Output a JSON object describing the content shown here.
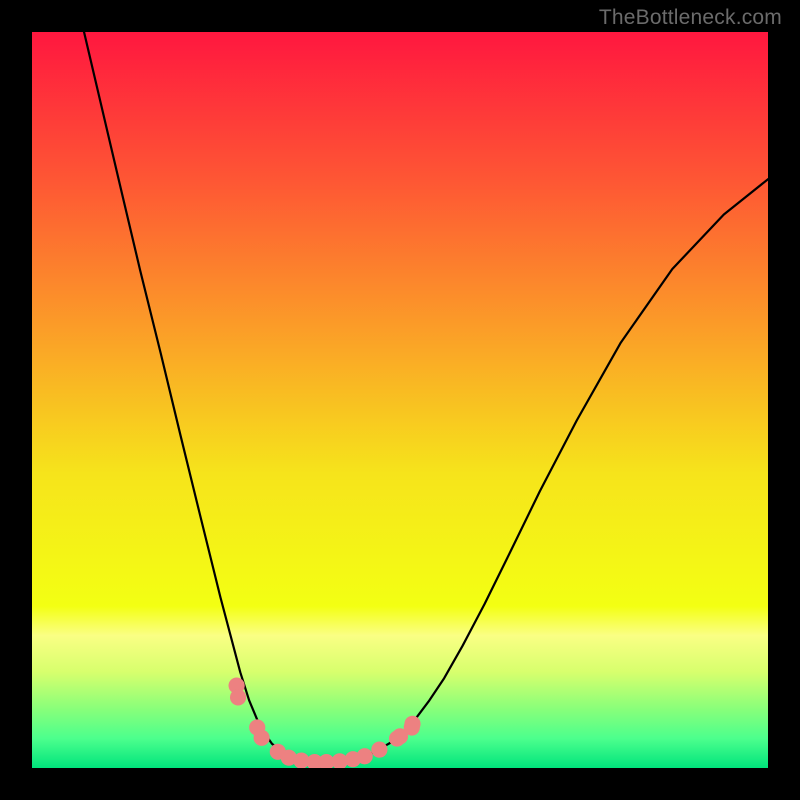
{
  "watermark": "TheBottleneck.com",
  "chart_data": {
    "type": "line",
    "title": "",
    "xlabel": "",
    "ylabel": "",
    "xlim": [
      0,
      1
    ],
    "ylim": [
      0,
      1
    ],
    "grid": false,
    "legend": false,
    "annotations": [],
    "gradient_stops": [
      {
        "offset": 0.0,
        "color": "#ff173f"
      },
      {
        "offset": 0.2,
        "color": "#fe5634"
      },
      {
        "offset": 0.4,
        "color": "#fb9c28"
      },
      {
        "offset": 0.6,
        "color": "#f6e41b"
      },
      {
        "offset": 0.78,
        "color": "#f3ff13"
      },
      {
        "offset": 0.82,
        "color": "#faff84"
      },
      {
        "offset": 0.87,
        "color": "#d7ff6d"
      },
      {
        "offset": 0.92,
        "color": "#88ff7a"
      },
      {
        "offset": 0.96,
        "color": "#4cff8d"
      },
      {
        "offset": 1.0,
        "color": "#00e47c"
      }
    ],
    "series": [
      {
        "name": "curve",
        "color": "#000000",
        "width": 2.2,
        "x": [
          0.066,
          0.093,
          0.12,
          0.147,
          0.175,
          0.202,
          0.229,
          0.256,
          0.283,
          0.295,
          0.31,
          0.326,
          0.345,
          0.366,
          0.392,
          0.428,
          0.46,
          0.49,
          0.516,
          0.54,
          0.56,
          0.585,
          0.615,
          0.65,
          0.69,
          0.74,
          0.8,
          0.87,
          0.94,
          1.0
        ],
        "y": [
          1.02,
          0.905,
          0.79,
          0.676,
          0.563,
          0.451,
          0.341,
          0.232,
          0.13,
          0.092,
          0.056,
          0.033,
          0.018,
          0.01,
          0.008,
          0.01,
          0.019,
          0.036,
          0.06,
          0.092,
          0.122,
          0.166,
          0.223,
          0.294,
          0.376,
          0.472,
          0.578,
          0.678,
          0.752,
          0.8
        ]
      }
    ],
    "markers": {
      "name": "dots",
      "color": "#ed8181",
      "radius_norm": 0.011,
      "x": [
        0.278,
        0.28,
        0.306,
        0.312,
        0.334,
        0.349,
        0.366,
        0.384,
        0.4,
        0.418,
        0.436,
        0.452,
        0.472,
        0.496,
        0.5,
        0.516,
        0.517
      ],
      "y": [
        0.112,
        0.096,
        0.055,
        0.041,
        0.022,
        0.014,
        0.01,
        0.008,
        0.008,
        0.009,
        0.012,
        0.016,
        0.025,
        0.04,
        0.043,
        0.055,
        0.06
      ]
    }
  }
}
